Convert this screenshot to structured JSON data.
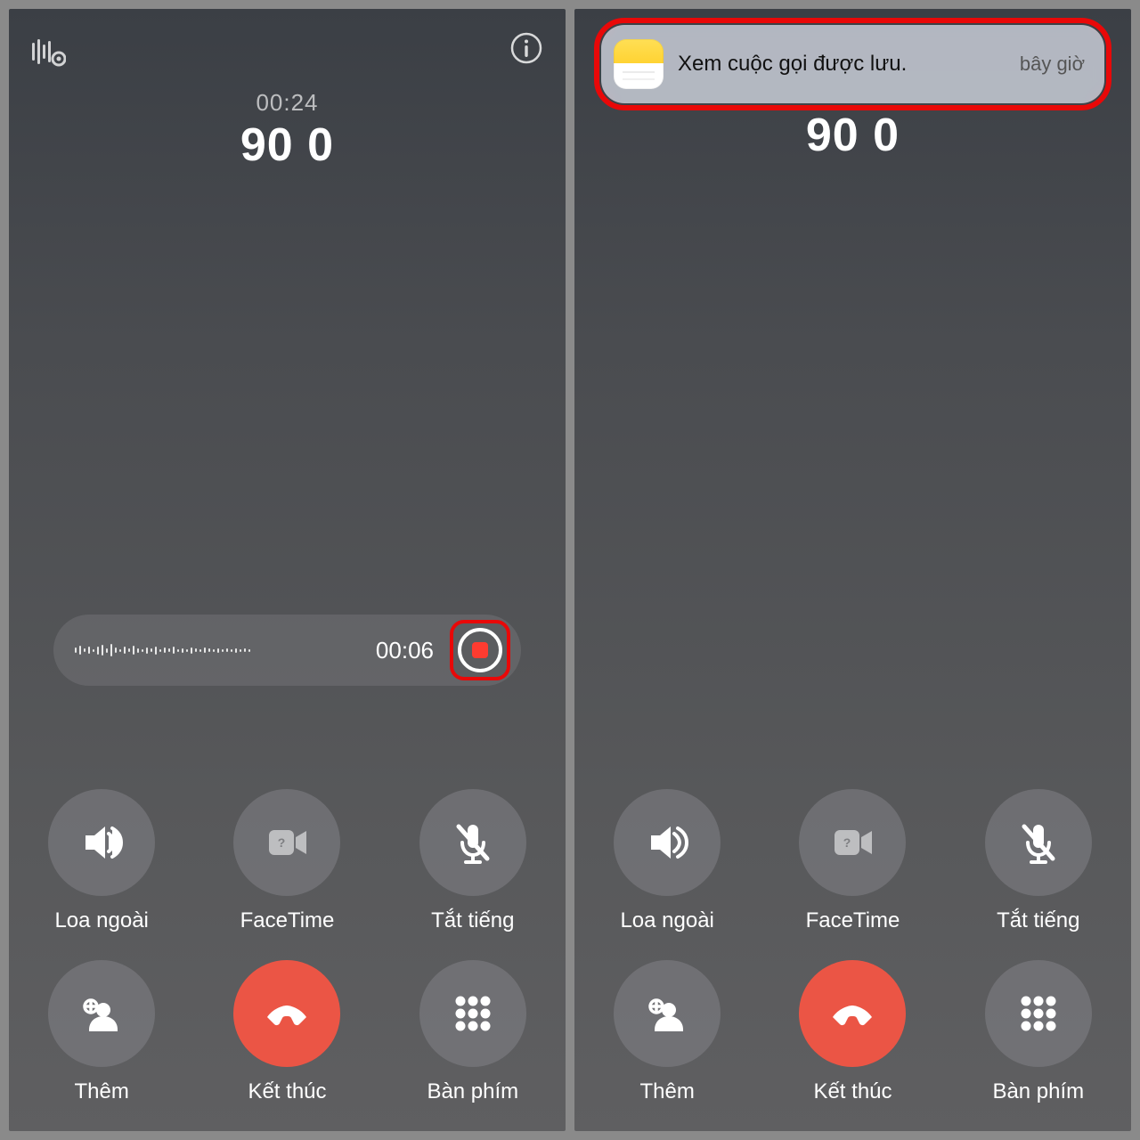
{
  "left": {
    "timer": "00:24",
    "caller": "90 0",
    "rec_time": "00:06",
    "buttons": {
      "speaker": "Loa ngoài",
      "facetime": "FaceTime",
      "mute": "Tắt tiếng",
      "more": "Thêm",
      "end": "Kết thúc",
      "keypad": "Bàn phím"
    }
  },
  "right": {
    "caller": "90 0",
    "notification": {
      "text": "Xem cuộc gọi được lưu.",
      "time": "bây giờ"
    },
    "buttons": {
      "speaker": "Loa ngoài",
      "facetime": "FaceTime",
      "mute": "Tắt tiếng",
      "more": "Thêm",
      "end": "Kết thúc",
      "keypad": "Bàn phím"
    }
  }
}
